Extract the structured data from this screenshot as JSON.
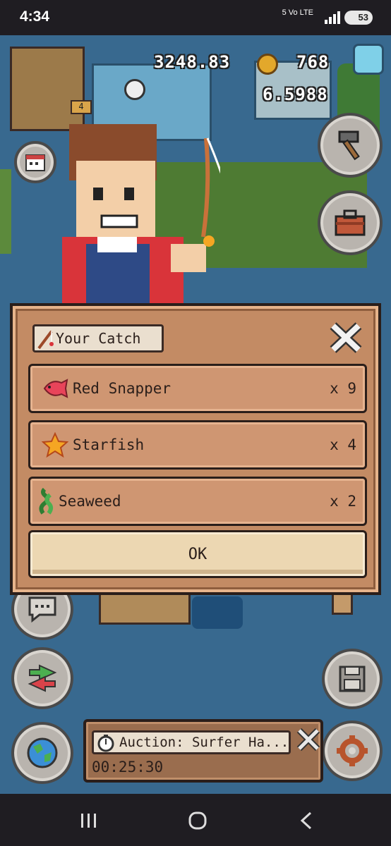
{
  "status_bar": {
    "time": "4:34",
    "network": "5 Vo LTE",
    "battery": "53"
  },
  "hud": {
    "money": "3248.83",
    "coins": "768",
    "rate": "6.5988",
    "bag_badge": "4"
  },
  "dialog": {
    "title": "Your Catch",
    "items": [
      {
        "name": "Red Snapper",
        "qty": "x 9",
        "icon": "red-snapper-icon",
        "color": "#e8445a"
      },
      {
        "name": "Starfish",
        "qty": "x 4",
        "icon": "starfish-icon",
        "color": "#f5a623"
      },
      {
        "name": "Seaweed",
        "qty": "x 2",
        "icon": "seaweed-icon",
        "color": "#4caf50"
      }
    ],
    "ok_label": "OK"
  },
  "auction": {
    "label": "Auction: Surfer Ha...",
    "timer": "00:25:30"
  },
  "colors": {
    "dialog_bg": "#c38b64",
    "row_bg": "#cf9672",
    "ok_bg": "#ecd7b2",
    "water": "#3c6e94"
  }
}
